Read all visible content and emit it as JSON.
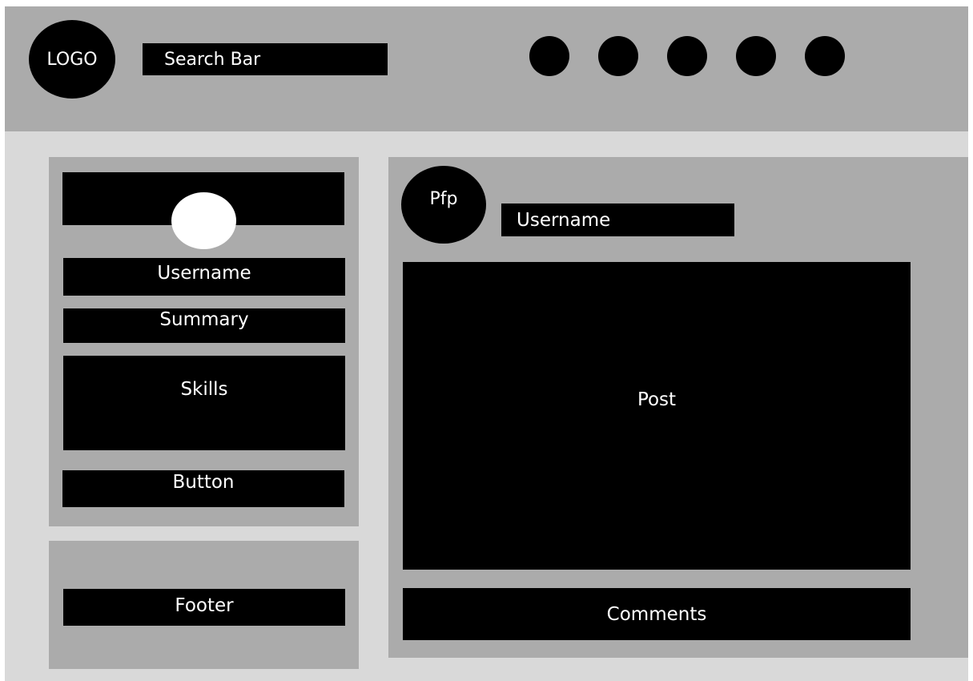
{
  "header": {
    "logo_text": "LOGO",
    "search_text": "Search Bar",
    "nav_icons": [
      "nav-circle-icon",
      "nav-circle-icon",
      "nav-circle-icon",
      "nav-circle-icon",
      "nav-circle-icon"
    ]
  },
  "profile_card": {
    "username": "Username",
    "summary": "Summary",
    "skills": "Skills",
    "button_label": "Button"
  },
  "footer": {
    "label": "Footer"
  },
  "post": {
    "pfp_label": "Pfp",
    "username": "Username",
    "content": "Post",
    "comments": "Comments"
  },
  "colors": {
    "page_background": "#d9d9d9",
    "panel": "#ababab",
    "block": "#000000",
    "text": "#ffffff"
  }
}
